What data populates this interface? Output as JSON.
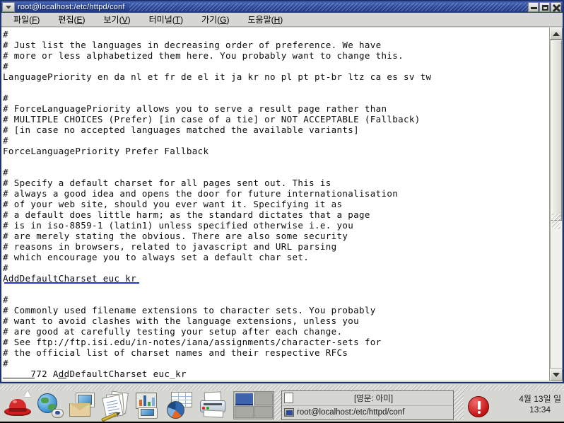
{
  "window": {
    "title": "root@localhost:/etc/httpd/conf",
    "menu_icon": "chevron-down-icon",
    "buttons": [
      {
        "name": "minimize",
        "glyph": "minimize-icon"
      },
      {
        "name": "maximize",
        "glyph": "maximize-icon"
      },
      {
        "name": "close",
        "glyph": "close-icon"
      }
    ]
  },
  "menubar": {
    "items": [
      {
        "label": "파일(F)",
        "pre": "파일(",
        "key": "F",
        "post": ")"
      },
      {
        "label": "편집(E)",
        "pre": "편집(",
        "key": "E",
        "post": ")"
      },
      {
        "label": "보기(V)",
        "pre": "보기(",
        "key": "V",
        "post": ")"
      },
      {
        "label": "터미널(T)",
        "pre": "터미널(",
        "key": "T",
        "post": ")"
      },
      {
        "label": "가기(G)",
        "pre": "가기(",
        "key": "G",
        "post": ")"
      },
      {
        "label": "도움말(H)",
        "pre": "도움말(",
        "key": "H",
        "post": ")"
      }
    ]
  },
  "terminal": {
    "lines": [
      "#",
      "# Just list the languages in decreasing order of preference. We have",
      "# more or less alphabetized them here. You probably want to change this.",
      "#",
      "LanguagePriority en da nl et fr de el it ja kr no pl pt pt-br ltz ca es sv tw",
      "",
      "#",
      "# ForceLanguagePriority allows you to serve a result page rather than",
      "# MULTIPLE CHOICES (Prefer) [in case of a tie] or NOT ACCEPTABLE (Fallback)",
      "# [in case no accepted languages matched the available variants]",
      "#",
      "ForceLanguagePriority Prefer Fallback",
      "",
      "#",
      "# Specify a default charset for all pages sent out. This is",
      "# always a good idea and opens the door for future internationalisation",
      "# of your web site, should you ever want it. Specifying it as",
      "# a default does little harm; as the standard dictates that a page",
      "# is in iso-8859-1 (latin1) unless specified otherwise i.e. you",
      "# are merely stating the obvious. There are also some security",
      "# reasons in browsers, related to javascript and URL parsing",
      "# which encourage you to always set a default char set.",
      "#",
      "AddDefaultCharset euc_kr",
      "",
      "#",
      "# Commonly used filename extensions to character sets. You probably",
      "# want to avoid clashes with the language extensions, unless you",
      "# are good at carefully testing your setup after each change.",
      "# See ftp://ftp.isi.edu/in-notes/iana/assignments/character-sets for",
      "# the official list of charset names and their respective RFCs",
      "#",
      "     772 AddDefaultCharset euc_kr"
    ],
    "highlighted_line_index": 23,
    "status_line_index": 32,
    "highlight_color": "#2631e0"
  },
  "scrollbar": {
    "up_icon": "triangle-up-icon",
    "down_icon": "triangle-down-icon"
  },
  "taskbar": {
    "launchers": [
      {
        "name": "red-hat-menu",
        "icon": "red-hat-icon"
      },
      {
        "name": "web-browser",
        "icon": "globe-mouse-icon"
      },
      {
        "name": "mail-client",
        "icon": "envelope-icon"
      },
      {
        "name": "text-editor",
        "icon": "document-pen-icon"
      },
      {
        "name": "presentation",
        "icon": "presentation-icon"
      },
      {
        "name": "spreadsheet",
        "icon": "spreadsheet-pie-icon"
      },
      {
        "name": "printer",
        "icon": "printer-icon"
      }
    ],
    "workspaces": [
      {
        "active": true
      },
      {
        "active": false
      },
      {
        "active": false
      },
      {
        "active": false
      }
    ],
    "tasks": [
      {
        "label": "[영문: 아미]",
        "icon": "document-icon",
        "align": "center"
      },
      {
        "label": "root@localhost:/etc/httpd/conf",
        "icon": "terminal-icon",
        "align": "left"
      }
    ],
    "alert": {
      "icon": "alert-exclamation-icon",
      "color": "#c31414"
    },
    "clock": {
      "date": "4월 13일 일",
      "time": "13:34"
    }
  }
}
